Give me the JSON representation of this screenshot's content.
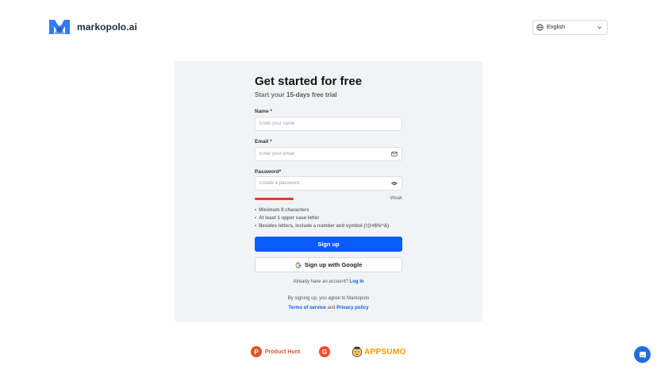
{
  "brand": {
    "name": "markopolo.ai",
    "color": "#2f7cf6"
  },
  "language": {
    "selected": "English",
    "icon": "globe-icon"
  },
  "signup": {
    "title": "Get started for free",
    "subtitle_prefix": "Start your ",
    "subtitle_bold": "15-days free trial",
    "name_label": "Name *",
    "name_placeholder": "Enter your name",
    "email_label": "Email *",
    "email_placeholder": "Enter your email",
    "password_label": "Password*",
    "password_placeholder": "Create a password",
    "strength_label": "Weak",
    "strength_fraction": 0.35,
    "strength_color": "#e53935",
    "rules": [
      "Minimum 8 characters",
      "At least 1 upper case letter",
      "Besides letters, include a number and symbol (!@#$%^&)"
    ],
    "signup_button": "Sign up",
    "google_button": "Sign up with Google",
    "login_prompt": "Already have an account?",
    "login_link": "Log In",
    "legal_prefix": "By signing up, you agree to Markopolo",
    "terms_link": "Terms of service",
    "legal_and": "and",
    "privacy_link": "Privacy policy",
    "accent_color": "#0b5cff"
  },
  "badges": {
    "producthunt_letter": "P",
    "producthunt_label": "Product Hunt",
    "g2_letter": "G",
    "appsumo_label": "APPSUMO"
  },
  "chat": {
    "icon": "chat-bubble-icon"
  }
}
